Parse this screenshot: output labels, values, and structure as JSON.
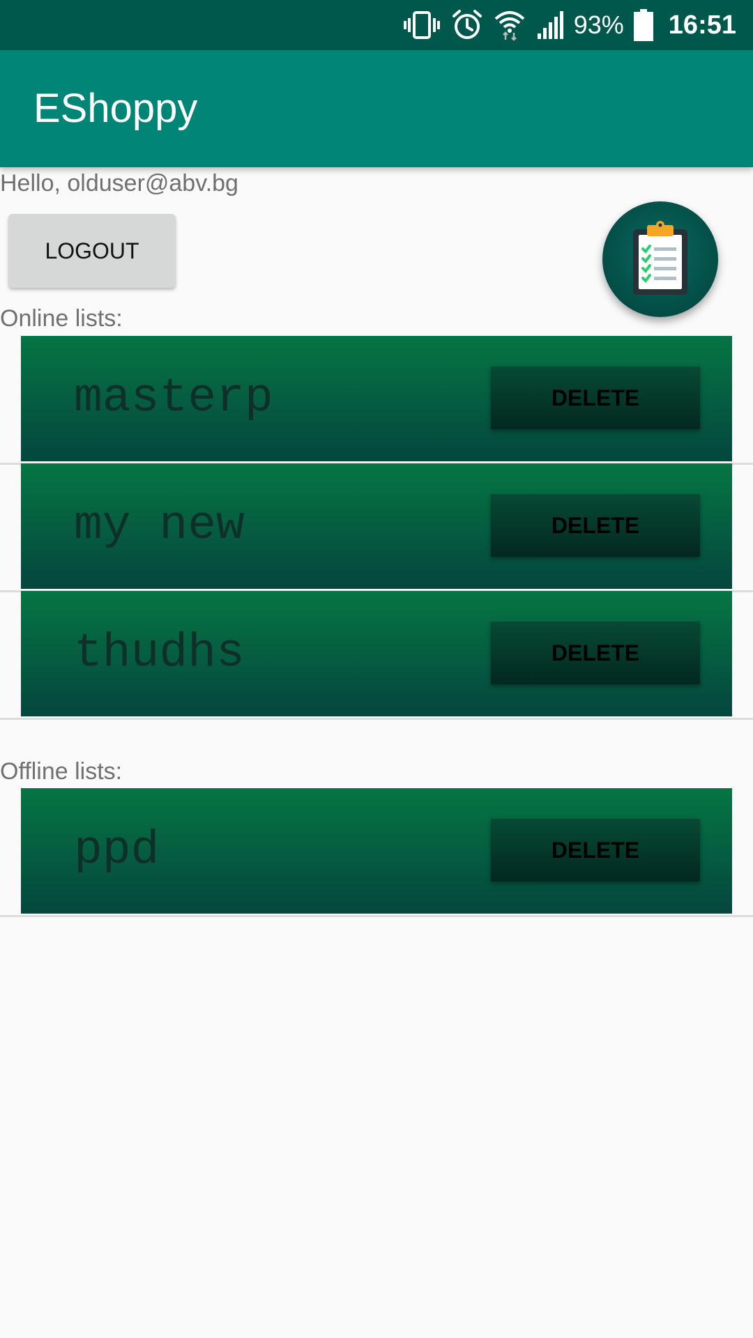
{
  "status_bar": {
    "battery_percent": "93%",
    "time": "16:51",
    "icons": [
      "vibrate-icon",
      "alarm-icon",
      "wifi-icon",
      "signal-icon",
      "battery-icon"
    ]
  },
  "app_bar": {
    "title": "EShoppy"
  },
  "greeting": "Hello, olduser@abv.bg",
  "logout_label": "LOGOUT",
  "fab": {
    "icon": "clipboard-checklist-icon"
  },
  "online": {
    "label": "Online lists:",
    "items": [
      {
        "name": "masterp",
        "delete_label": "DELETE"
      },
      {
        "name": "my new",
        "delete_label": "DELETE"
      },
      {
        "name": "thudhs",
        "delete_label": "DELETE"
      }
    ]
  },
  "offline": {
    "label": "Offline lists:",
    "items": [
      {
        "name": "ppd",
        "delete_label": "DELETE"
      }
    ]
  },
  "colors": {
    "status_bar": "#00574b",
    "app_bar": "#008577",
    "card_top": "#067544",
    "card_bottom": "#05463d",
    "background": "#fafafa"
  }
}
